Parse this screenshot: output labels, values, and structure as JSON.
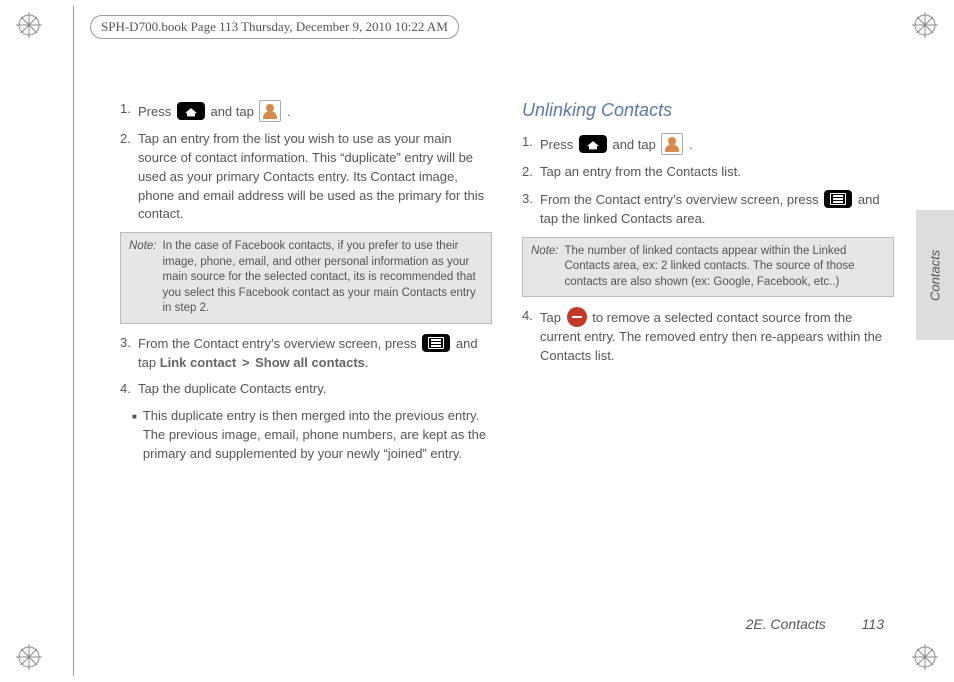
{
  "header": {
    "text": "SPH-D700.book  Page 113  Thursday, December 9, 2010  10:22 AM"
  },
  "left_col": {
    "items": [
      {
        "num": "1.",
        "pre": "Press ",
        "mid": " and tap ",
        "post": " ."
      },
      {
        "num": "2.",
        "text": "Tap an entry from the list you wish to use as your main source of contact information. This “duplicate” entry will be used as your primary Contacts entry. Its Contact image, phone and email address will be used as the primary for this contact."
      },
      {
        "note_label": "Note:",
        "note_text": "In the case of Facebook contacts, if you prefer to use their image, phone, email, and other personal information as your main source for the selected contact, its is recommended that you select this Facebook contact as your main Contacts entry in step 2."
      },
      {
        "num": "3.",
        "pre": "From the Contact entry’s overview screen, press ",
        "mid": " and tap ",
        "link1": "Link contact",
        "gt": ">",
        "link2": "Show all contacts",
        "post": "."
      },
      {
        "num": "4.",
        "text": "Tap the duplicate Contacts entry."
      },
      {
        "bullet": "This duplicate entry is then merged into the previous entry. The previous image, email, phone numbers, are kept as the primary and supplemented by your newly “joined” entry."
      }
    ]
  },
  "right_col": {
    "title": "Unlinking Contacts",
    "items": [
      {
        "num": "1.",
        "pre": "Press ",
        "mid": " and tap ",
        "post": " ."
      },
      {
        "num": "2.",
        "text": "Tap an entry from the Contacts list."
      },
      {
        "num": "3.",
        "pre": "From the Contact entry’s overview screen, press ",
        "mid": " and tap the linked Contacts area."
      },
      {
        "note_label": "Note:",
        "note_text": "The number of linked contacts appear within the Linked Contacts area, ex: 2 linked contacts. The source of those contacts are also shown (ex: Google, Facebook, etc..)"
      },
      {
        "num": "4.",
        "pre": "Tap ",
        "mid": " to remove a selected contact source from the current entry. The removed entry then re-appears within the Contacts list."
      }
    ]
  },
  "footer": {
    "section": "2E. Contacts",
    "page": "113"
  },
  "side_tab": "Contacts",
  "icons": {
    "home": "home-key-icon",
    "menu": "menu-key-icon",
    "contact": "contacts-app-icon",
    "minus": "remove-icon"
  }
}
